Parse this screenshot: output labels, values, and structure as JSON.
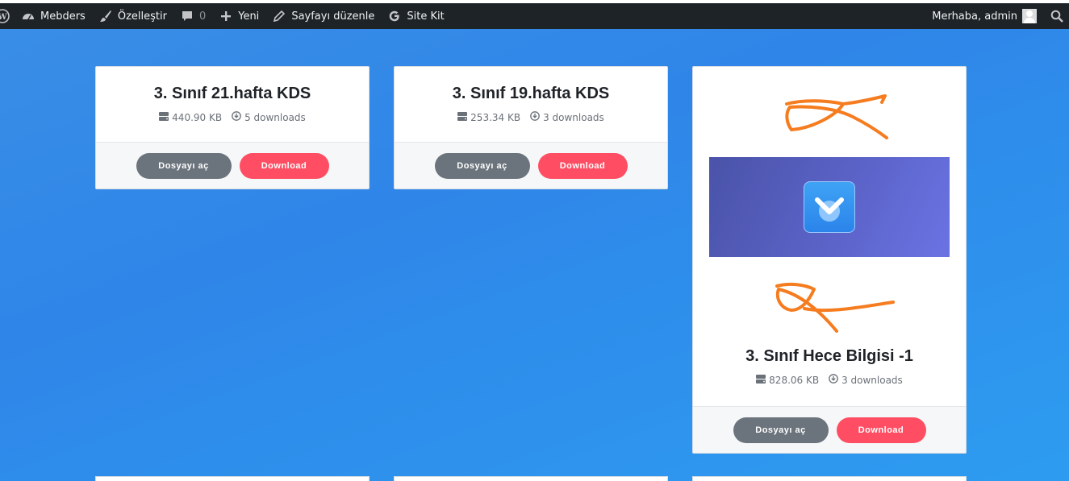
{
  "adminbar": {
    "site_name": "Mebders",
    "customize": "Özelleştir",
    "comments_count": "0",
    "new": "Yeni",
    "edit_page": "Sayfayı düzenle",
    "site_kit": "Site Kit",
    "greeting": "Merhaba, admin"
  },
  "cards": [
    {
      "title": "3. Sınıf 21.hafta KDS",
      "size": "440.90 KB",
      "downloads": "5 downloads",
      "open_label": "Dosyayı aç",
      "download_label": "Download"
    },
    {
      "title": "3. Sınıf 19.hafta KDS",
      "size": "253.34 KB",
      "downloads": "3 downloads",
      "open_label": "Dosyayı aç",
      "download_label": "Download"
    },
    {
      "title": "3. Sınıf Hece Bilgisi -1",
      "size": "828.06 KB",
      "downloads": "3 downloads",
      "open_label": "Dosyayı aç",
      "download_label": "Download"
    }
  ],
  "icons": {
    "wp": "wordpress-logo-icon",
    "dashboard": "dashboard-icon",
    "brush": "brush-icon",
    "comment": "comment-icon",
    "plus": "plus-icon",
    "pencil": "pencil-icon",
    "google": "google-g-icon",
    "search": "search-icon",
    "server": "server-icon",
    "download": "download-circle-icon"
  },
  "colors": {
    "background": "#2f86e8",
    "adminbar": "#1d2327",
    "open_button": "#6b737c",
    "download_button": "#ff4e63",
    "scribble": "#f57c1f"
  }
}
